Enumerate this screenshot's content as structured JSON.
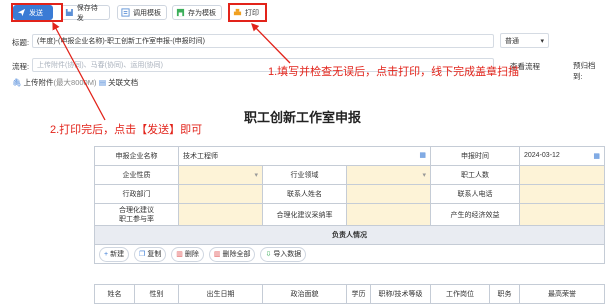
{
  "toolbar": {
    "send": "发送",
    "save_draft": "保存待发",
    "call_template": "调用模板",
    "save_template": "存为模板",
    "print": "打印"
  },
  "form_header": {
    "title_label": "标题:",
    "title_value": "(年度)-(申报企业名称)-职工创新工作室申报-(申报时间)",
    "priority_value": "普通",
    "process_label": "流程:",
    "process_placeholder": "上传附件(协同)、马春(协同)、运用(协同)",
    "view_process": "查看流程",
    "deadline_label": "预归档到:",
    "attach_label": "上传附件",
    "attach_hint": "(最大8000M)",
    "related_doc": "关联文档"
  },
  "annotations": {
    "step1": "1.填写并检查无误后，点击打印，线下完成盖章扫描",
    "step2": "2.打印完后，点击【发送】即可"
  },
  "document": {
    "title": "职工创新工作室申报"
  },
  "form": {
    "row1": {
      "company_label": "申报企业名称",
      "company_value": "技术工程师",
      "date_label": "申报时间",
      "date_value": "2024-03-12"
    },
    "row2": {
      "nature_label": "企业性质",
      "industry_label": "行业领域",
      "staff_label": "职工人数"
    },
    "row3": {
      "dept_label": "行政部门",
      "contact_label": "联系人姓名",
      "phone_label": "联系人电话"
    },
    "row4": {
      "suggest_label": "合理化建议\n职工参与率",
      "adopt_label": "合理化建议采纳率",
      "benefit_label": "产生的经济效益"
    },
    "section_title": "负责人情况",
    "actions": [
      "新建",
      "复制",
      "删除",
      "删除全部",
      "导入数据"
    ],
    "columns": [
      "姓名",
      "性别",
      "出生日期",
      "政治面貌",
      "学历",
      "职称/技术等级",
      "工作岗位",
      "职务",
      "最高荣誉"
    ]
  }
}
